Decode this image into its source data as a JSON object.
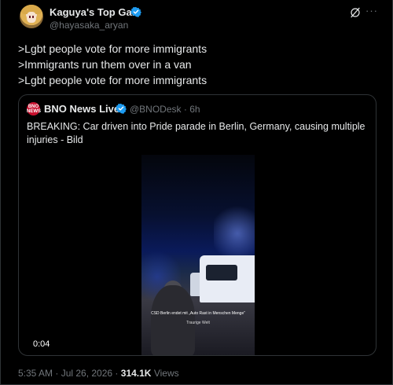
{
  "author": {
    "display_name": "Kaguya's Top Gal",
    "handle": "@hayasaka_aryan",
    "verified": true
  },
  "header_actions": {
    "grok_icon": "grok-icon",
    "more_label": "···"
  },
  "body_lines": [
    ">Lgbt people vote for more immigrants",
    ">Immigrants run them over in a van",
    ">Lgbt people vote for more immigrants"
  ],
  "quote": {
    "logo_text": "BNO NEWS",
    "display_name": "BNO News Live",
    "handle": "@BNODesk",
    "separator": "·",
    "time": "6h",
    "text": "BREAKING: Car driven into Pride parade in Berlin, Germany, causing multiple injuries - Bild",
    "video": {
      "caption_line1": "CSD Berlin endet mit „Auto Rast in Menschen Menge“",
      "caption_line2": "Traurige Welt",
      "duration": "0:04"
    }
  },
  "footer": {
    "timestamp": "5:35 AM · Jul 26, 2026",
    "separator": "·",
    "views_count": "314.1K",
    "views_label": "Views"
  },
  "colors": {
    "background": "#000000",
    "primary_text": "#e7e9ea",
    "secondary_text": "#71767b",
    "border": "#2f3336",
    "verified_blue": "#1d9bf0"
  }
}
